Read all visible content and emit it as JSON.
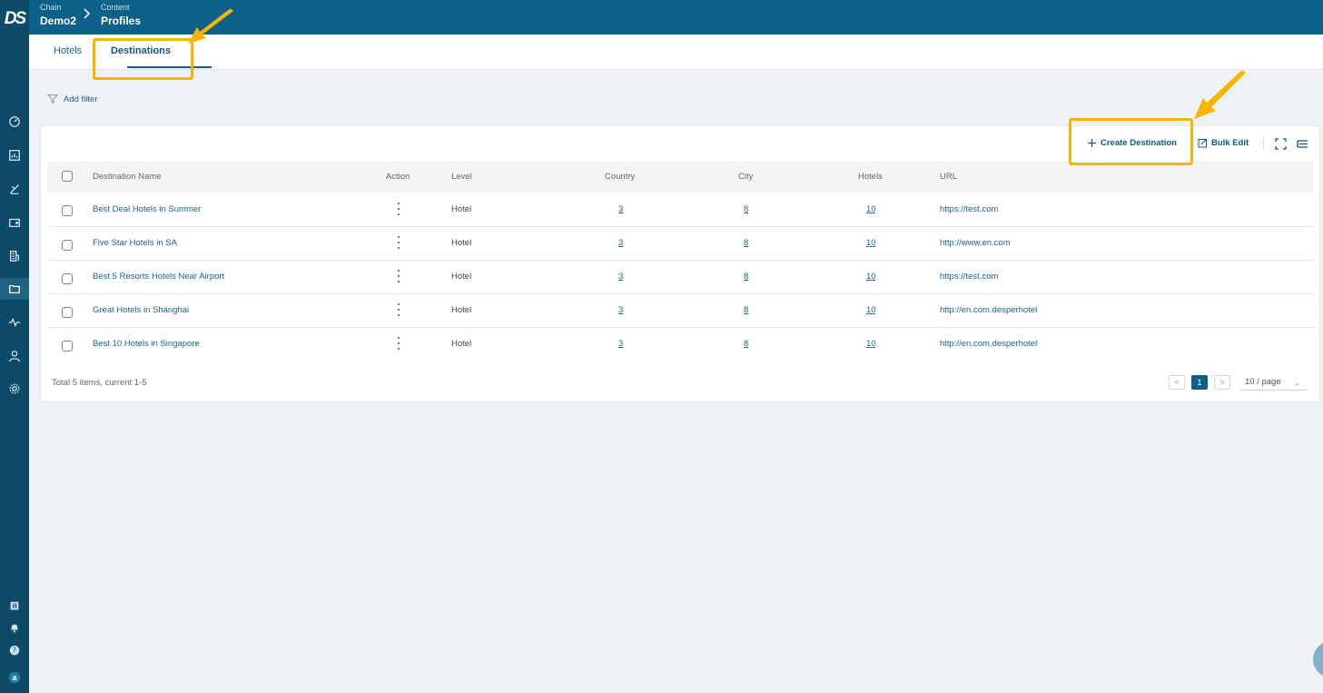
{
  "header": {
    "crumb1": {
      "small": "Chain",
      "big": "Demo2"
    },
    "crumb2": {
      "small": "Content",
      "big": "Profiles"
    }
  },
  "logo": "DS",
  "tabs": [
    {
      "label": "Hotels",
      "active": false
    },
    {
      "label": "Destinations",
      "active": true
    }
  ],
  "filter": {
    "label": "Add filter",
    "icon": "filter-icon"
  },
  "toolbar": {
    "create_label": "Create Destination",
    "bulk_label": "Bulk Edit",
    "fullscreen_icon": "fullscreen-icon",
    "density_icon": "column-settings-icon"
  },
  "table": {
    "columns": [
      "Destination Name",
      "Action",
      "Level",
      "Country",
      "City",
      "Hotels",
      "URL"
    ],
    "rows": [
      {
        "name": "Best Deal Hotels in Summer",
        "level": "Hotel",
        "country": "3",
        "city": "8",
        "hotels": "10",
        "url": "https://test.com"
      },
      {
        "name": "Five Star Hotels in SA",
        "level": "Hotel",
        "country": "3",
        "city": "8",
        "hotels": "10",
        "url": "http://www.en.com"
      },
      {
        "name": "Best 5 Resorts Hotels Near Airport",
        "level": "Hotel",
        "country": "3",
        "city": "8",
        "hotels": "10",
        "url": "https://test.com"
      },
      {
        "name": "Great Hotels in Shanghai",
        "level": "Hotel",
        "country": "3",
        "city": "8",
        "hotels": "10",
        "url": "http://en.com.desperhotel"
      },
      {
        "name": "Best 10 Hotels in Singapore",
        "level": "Hotel",
        "country": "3",
        "city": "8",
        "hotels": "10",
        "url": "http://en.com.desperhotel"
      }
    ]
  },
  "pagination": {
    "total_text": "Total 5 items, current 1-5",
    "current_page": "1",
    "page_size": "10 / page",
    "prev": "<",
    "next": ">"
  },
  "sidebar_bottom": {
    "avatar_letter": "a"
  },
  "colors": {
    "nav_bg": "#0d4a68",
    "header_bg": "#0d6087",
    "highlight": "#f7b500"
  }
}
